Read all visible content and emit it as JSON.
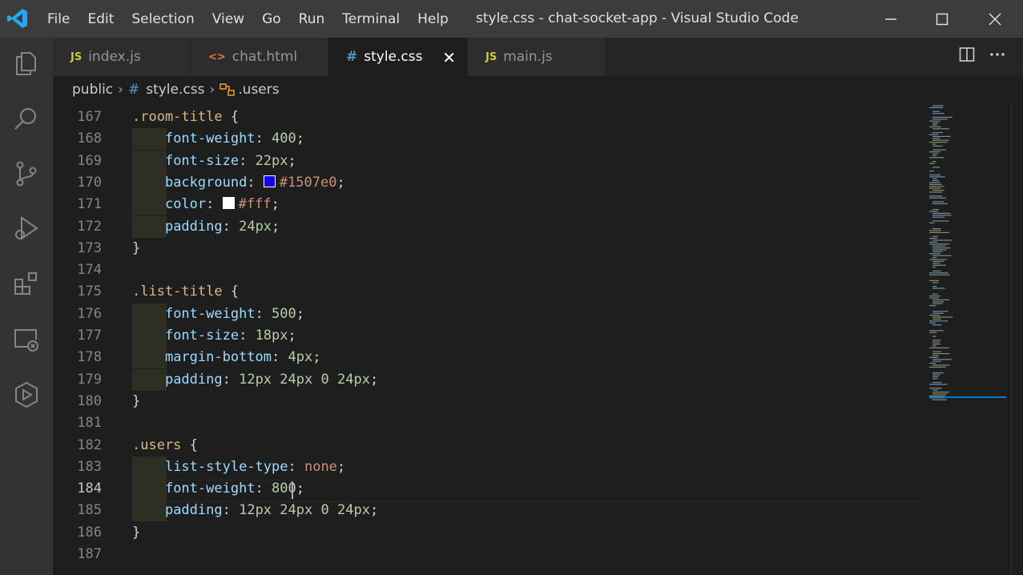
{
  "menu": [
    "File",
    "Edit",
    "Selection",
    "View",
    "Go",
    "Run",
    "Terminal",
    "Help"
  ],
  "window_title": "style.css - chat-socket-app - Visual Studio Code",
  "tabs": [
    {
      "icon": "JS",
      "label": "index.js"
    },
    {
      "icon": "<>",
      "label": "chat.html"
    },
    {
      "icon": "#",
      "label": "style.css",
      "active": true
    },
    {
      "icon": "JS",
      "label": "main.js"
    }
  ],
  "breadcrumb": {
    "folder": "public",
    "file": "style.css",
    "symbol": ".users"
  },
  "lines": [
    {
      "n": "167",
      "code": ".room-title {"
    },
    {
      "n": "168",
      "code": "    font-weight: 400;"
    },
    {
      "n": "169",
      "code": "    font-size: 22px;"
    },
    {
      "n": "170",
      "code": "    background: #1507e0;"
    },
    {
      "n": "171",
      "code": "    color: #fff;"
    },
    {
      "n": "172",
      "code": "    padding: 24px;"
    },
    {
      "n": "173",
      "code": "}"
    },
    {
      "n": "174",
      "code": ""
    },
    {
      "n": "175",
      "code": ".list-title {"
    },
    {
      "n": "176",
      "code": "    font-weight: 500;"
    },
    {
      "n": "177",
      "code": "    font-size: 18px;"
    },
    {
      "n": "178",
      "code": "    margin-bottom: 4px;"
    },
    {
      "n": "179",
      "code": "    padding: 12px 24px 0 24px;"
    },
    {
      "n": "180",
      "code": "}"
    },
    {
      "n": "181",
      "code": ""
    },
    {
      "n": "182",
      "code": ".users {"
    },
    {
      "n": "183",
      "code": "    list-style-type: none;"
    },
    {
      "n": "184",
      "code": "    font-weight: 800;"
    },
    {
      "n": "185",
      "code": "    padding: 12px 24px 0 24px;"
    },
    {
      "n": "186",
      "code": "}"
    },
    {
      "n": "187",
      "code": ""
    }
  ],
  "colors": {
    "swatch_bg": "#1507e0",
    "swatch_color": "#ffffff",
    "accent": "#007acc"
  }
}
